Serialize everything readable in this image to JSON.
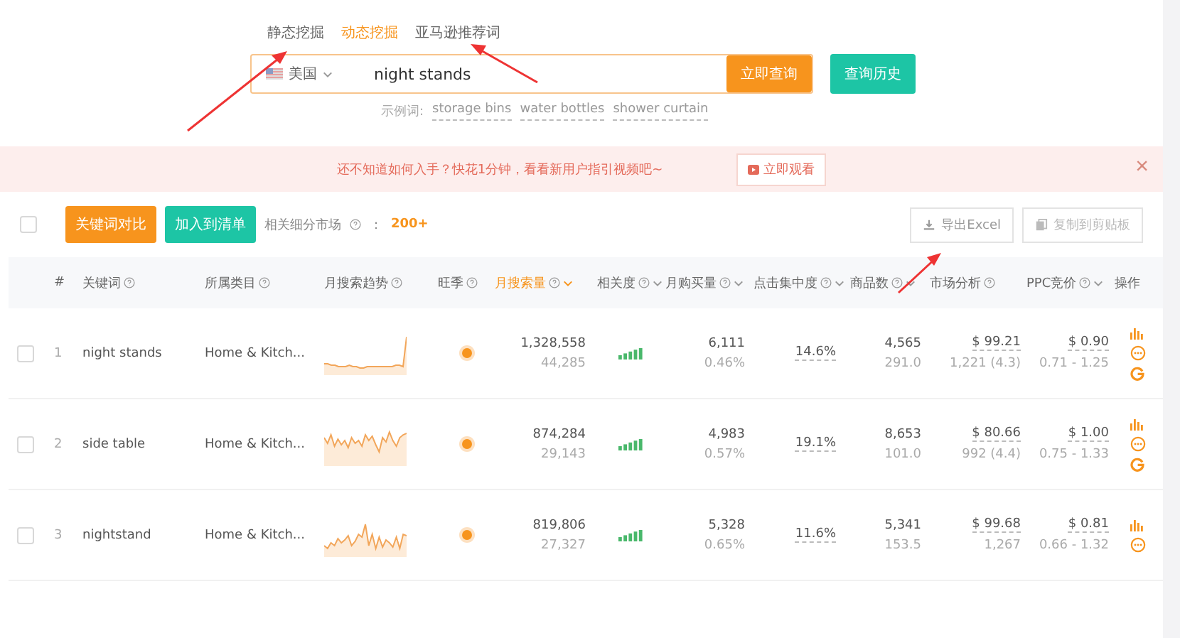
{
  "tabs": [
    {
      "label": "静态挖掘",
      "selected": false
    },
    {
      "label": "动态挖掘",
      "selected": true
    },
    {
      "label": "亚马逊推荐词",
      "selected": false
    }
  ],
  "search": {
    "country": "美国",
    "value": "night stands",
    "submit": "立即查询",
    "history": "查询历史"
  },
  "examples": {
    "label": "示例词:",
    "words": [
      "storage bins",
      "water bottles",
      "shower curtain"
    ]
  },
  "banner": {
    "text": "还不知道如何入手？快花1分钟，看看新用户指引视频吧~",
    "button": "立即观看",
    "close": "×"
  },
  "toolbar": {
    "select_all_checked": false,
    "compare": "关键词对比",
    "add": "加入到清单",
    "related_label": "相关细分市场",
    "related_sep": "：",
    "related_count": "200+",
    "export": "导出Excel",
    "copy": "复制到剪贴板"
  },
  "columns": [
    {
      "label": "#",
      "help": false,
      "sortable": false,
      "selected": false
    },
    {
      "label": "关键词",
      "help": true,
      "sortable": false,
      "selected": false
    },
    {
      "label": "所属类目",
      "help": true,
      "sortable": false,
      "selected": false
    },
    {
      "label": "月搜索趋势",
      "help": true,
      "sortable": false,
      "selected": false
    },
    {
      "label": "旺季",
      "help": true,
      "sortable": false,
      "selected": false
    },
    {
      "label": "月搜索量",
      "help": true,
      "sortable": true,
      "selected": true
    },
    {
      "label": "相关度",
      "help": true,
      "sortable": true,
      "selected": false
    },
    {
      "label": "月购买量",
      "help": true,
      "sortable": true,
      "selected": false
    },
    {
      "label": "点击集中度",
      "help": true,
      "sortable": true,
      "selected": false
    },
    {
      "label": "商品数",
      "help": true,
      "sortable": true,
      "selected": false
    },
    {
      "label": "市场分析",
      "help": true,
      "sortable": false,
      "selected": false
    },
    {
      "label": "PPC竞价",
      "help": true,
      "sortable": true,
      "selected": false
    },
    {
      "label": "操作",
      "help": false,
      "sortable": false,
      "selected": false
    }
  ],
  "rows": [
    {
      "index": "1",
      "keyword": "night stands",
      "category": "Home & Kitch...",
      "searches": "1,328,558",
      "searches_sub": "44,285",
      "purchases": "6,111",
      "purchase_rate": "0.46%",
      "click_share": "14.6%",
      "products": "4,565",
      "products_sub": "291.0",
      "price": "$ 99.21",
      "reviews": "1,221 (4.3)",
      "ppc": "$ 0.90",
      "ppc_range": "0.71 - 1.25",
      "checked": false,
      "actions": [
        {
          "kind": "chart"
        },
        {
          "kind": "chat"
        },
        {
          "kind": "google"
        }
      ]
    },
    {
      "index": "2",
      "keyword": "side table",
      "category": "Home & Kitch...",
      "searches": "874,284",
      "searches_sub": "29,143",
      "purchases": "4,983",
      "purchase_rate": "0.57%",
      "click_share": "19.1%",
      "products": "8,653",
      "products_sub": "101.0",
      "price": "$ 80.66",
      "reviews": "992 (4.4)",
      "ppc": "$ 1.00",
      "ppc_range": "0.75 - 1.33",
      "checked": false,
      "actions": [
        {
          "kind": "chart"
        },
        {
          "kind": "chat"
        },
        {
          "kind": "google"
        }
      ]
    },
    {
      "index": "3",
      "keyword": "nightstand",
      "category": "Home & Kitch...",
      "searches": "819,806",
      "searches_sub": "27,327",
      "purchases": "5,328",
      "purchase_rate": "0.65%",
      "click_share": "11.6%",
      "products": "5,341",
      "products_sub": "153.5",
      "price": "$ 99.68",
      "reviews": "1,267",
      "ppc": "$ 0.81",
      "ppc_range": "0.66 - 1.32",
      "checked": false,
      "actions": [
        {
          "kind": "chart"
        },
        {
          "kind": "chat"
        }
      ]
    }
  ]
}
